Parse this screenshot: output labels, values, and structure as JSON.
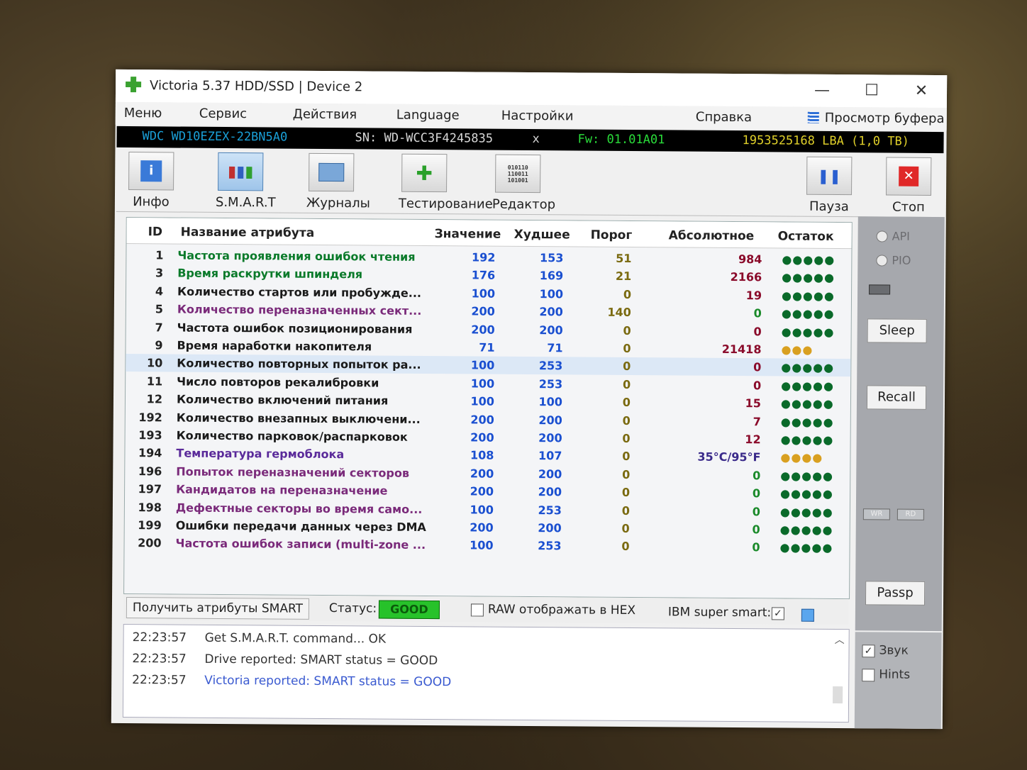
{
  "window": {
    "title": "Victoria 5.37 HDD/SSD | Device 2",
    "minimize": "—",
    "maximize": "☐",
    "close": "✕"
  },
  "menu": {
    "items": [
      "Меню",
      "Сервис",
      "Действия",
      "Language",
      "Настройки",
      "Справка"
    ],
    "buffer_view": "Просмотр буфера"
  },
  "drive": {
    "model": "WDC WD10EZEX-22BN5A0",
    "serial": "SN: WD-WCC3F4245835",
    "x": "x",
    "firmware": "Fw: 01.01A01",
    "capacity": "1953525168 LBA (1,0 TB)"
  },
  "toolbar": {
    "info": "Инфо",
    "smart": "S.M.A.R.T",
    "logs": "Журналы",
    "testing": "Тестирование",
    "editor": "Редактор",
    "pause": "Пауза",
    "stop": "Стоп"
  },
  "table": {
    "headers": {
      "id": "ID",
      "name": "Название атрибута",
      "value": "Значение",
      "worst": "Худшее",
      "threshold": "Порог",
      "raw": "Абсолютное",
      "remaining": "Остаток"
    },
    "rows": [
      {
        "id": "1",
        "name": "Частота проявления ошибок чтения",
        "value": "192",
        "worst": "153",
        "threshold": "51",
        "raw": "984",
        "remaining": "●●●●●",
        "name_color": "#0a7a2a",
        "raw_color": "#8a0a2a",
        "rem_color": "#0a6a2a"
      },
      {
        "id": "3",
        "name": "Время раскрутки шпинделя",
        "value": "176",
        "worst": "169",
        "threshold": "21",
        "raw": "2166",
        "remaining": "●●●●●",
        "name_color": "#0a7a2a",
        "raw_color": "#8a0a2a",
        "rem_color": "#0a6a2a"
      },
      {
        "id": "4",
        "name": "Количество стартов или пробужде...",
        "value": "100",
        "worst": "100",
        "threshold": "0",
        "raw": "19",
        "remaining": "●●●●●",
        "name_color": "#1a1a1a",
        "raw_color": "#8a0a2a",
        "rem_color": "#0a6a2a"
      },
      {
        "id": "5",
        "name": "Количество переназначенных сект...",
        "value": "200",
        "worst": "200",
        "threshold": "140",
        "raw": "0",
        "remaining": "●●●●●",
        "name_color": "#7a2a7a",
        "raw_color": "#1a8a2a",
        "rem_color": "#0a6a2a"
      },
      {
        "id": "7",
        "name": "Частота ошибок позиционирования",
        "value": "200",
        "worst": "200",
        "threshold": "0",
        "raw": "0",
        "remaining": "●●●●●",
        "name_color": "#1a1a1a",
        "raw_color": "#8a0a2a",
        "rem_color": "#0a6a2a"
      },
      {
        "id": "9",
        "name": "Время наработки накопителя",
        "value": "71",
        "worst": "71",
        "threshold": "0",
        "raw": "21418",
        "remaining": "●●●",
        "name_color": "#1a1a1a",
        "raw_color": "#8a0a2a",
        "rem_color": "#d9a020"
      },
      {
        "id": "10",
        "name": "Количество повторных попыток ра...",
        "value": "100",
        "worst": "253",
        "threshold": "0",
        "raw": "0",
        "remaining": "●●●●●",
        "name_color": "#1a1a1a",
        "raw_color": "#8a0a2a",
        "rem_color": "#0a6a2a"
      },
      {
        "id": "11",
        "name": "Число повторов рекалибровки",
        "value": "100",
        "worst": "253",
        "threshold": "0",
        "raw": "0",
        "remaining": "●●●●●",
        "name_color": "#1a1a1a",
        "raw_color": "#8a0a2a",
        "rem_color": "#0a6a2a"
      },
      {
        "id": "12",
        "name": "Количество включений питания",
        "value": "100",
        "worst": "100",
        "threshold": "0",
        "raw": "15",
        "remaining": "●●●●●",
        "name_color": "#1a1a1a",
        "raw_color": "#8a0a2a",
        "rem_color": "#0a6a2a"
      },
      {
        "id": "192",
        "name": "Количество внезапных выключени...",
        "value": "200",
        "worst": "200",
        "threshold": "0",
        "raw": "7",
        "remaining": "●●●●●",
        "name_color": "#1a1a1a",
        "raw_color": "#8a0a2a",
        "rem_color": "#0a6a2a"
      },
      {
        "id": "193",
        "name": "Количество парковок/распарковок",
        "value": "200",
        "worst": "200",
        "threshold": "0",
        "raw": "12",
        "remaining": "●●●●●",
        "name_color": "#1a1a1a",
        "raw_color": "#8a0a2a",
        "rem_color": "#0a6a2a"
      },
      {
        "id": "194",
        "name": "Температура гермоблока",
        "value": "108",
        "worst": "107",
        "threshold": "0",
        "raw": "35°C/95°F",
        "remaining": "●●●●",
        "name_color": "#5a2a9a",
        "raw_color": "#3a2a8a",
        "rem_color": "#d9a020"
      },
      {
        "id": "196",
        "name": "Попыток переназначений секторов",
        "value": "200",
        "worst": "200",
        "threshold": "0",
        "raw": "0",
        "remaining": "●●●●●",
        "name_color": "#7a2a7a",
        "raw_color": "#1a8a2a",
        "rem_color": "#0a6a2a"
      },
      {
        "id": "197",
        "name": "Кандидатов на переназначение",
        "value": "200",
        "worst": "200",
        "threshold": "0",
        "raw": "0",
        "remaining": "●●●●●",
        "name_color": "#7a2a7a",
        "raw_color": "#1a8a2a",
        "rem_color": "#0a6a2a"
      },
      {
        "id": "198",
        "name": "Дефектные секторы во время само...",
        "value": "100",
        "worst": "253",
        "threshold": "0",
        "raw": "0",
        "remaining": "●●●●●",
        "name_color": "#7a2a7a",
        "raw_color": "#1a8a2a",
        "rem_color": "#0a6a2a"
      },
      {
        "id": "199",
        "name": "Ошибки передачи данных через DMA",
        "value": "200",
        "worst": "200",
        "threshold": "0",
        "raw": "0",
        "remaining": "●●●●●",
        "name_color": "#1a1a1a",
        "raw_color": "#1a8a2a",
        "rem_color": "#0a6a2a"
      },
      {
        "id": "200",
        "name": "Частота ошибок записи (multi-zone ...",
        "value": "100",
        "worst": "253",
        "threshold": "0",
        "raw": "0",
        "remaining": "●●●●●",
        "name_color": "#7a2a7a",
        "raw_color": "#1a8a2a",
        "rem_color": "#0a6a2a"
      }
    ]
  },
  "status": {
    "get_smart": "Получить атрибуты SMART",
    "status_label": "Статус:",
    "status_value": "GOOD",
    "raw_hex": "RAW отображать в HEX",
    "ibm_smart": "IBM super smart:",
    "ibm_check": "✓"
  },
  "log": [
    {
      "time": "22:23:57",
      "msg": "Get S.M.A.R.T. command... OK",
      "color": "#333333"
    },
    {
      "time": "22:23:57",
      "msg": "Drive reported: SMART status = GOOD",
      "color": "#333333"
    },
    {
      "time": "22:23:57",
      "msg": "Victoria reported: SMART status = GOOD",
      "color": "#3a5ad0"
    }
  ],
  "sidebar": {
    "api": "API",
    "pio": "PIO",
    "sleep": "Sleep",
    "recall": "Recall",
    "wr": "WR",
    "rd": "RD",
    "passp": "Passp",
    "sound": "Звук",
    "sound_check": "✓",
    "hints": "Hints"
  },
  "colors": {
    "model": "#1aa0d8",
    "serial": "#d8d8d8",
    "firmware": "#2adc3a",
    "capacity": "#e0d02a"
  }
}
